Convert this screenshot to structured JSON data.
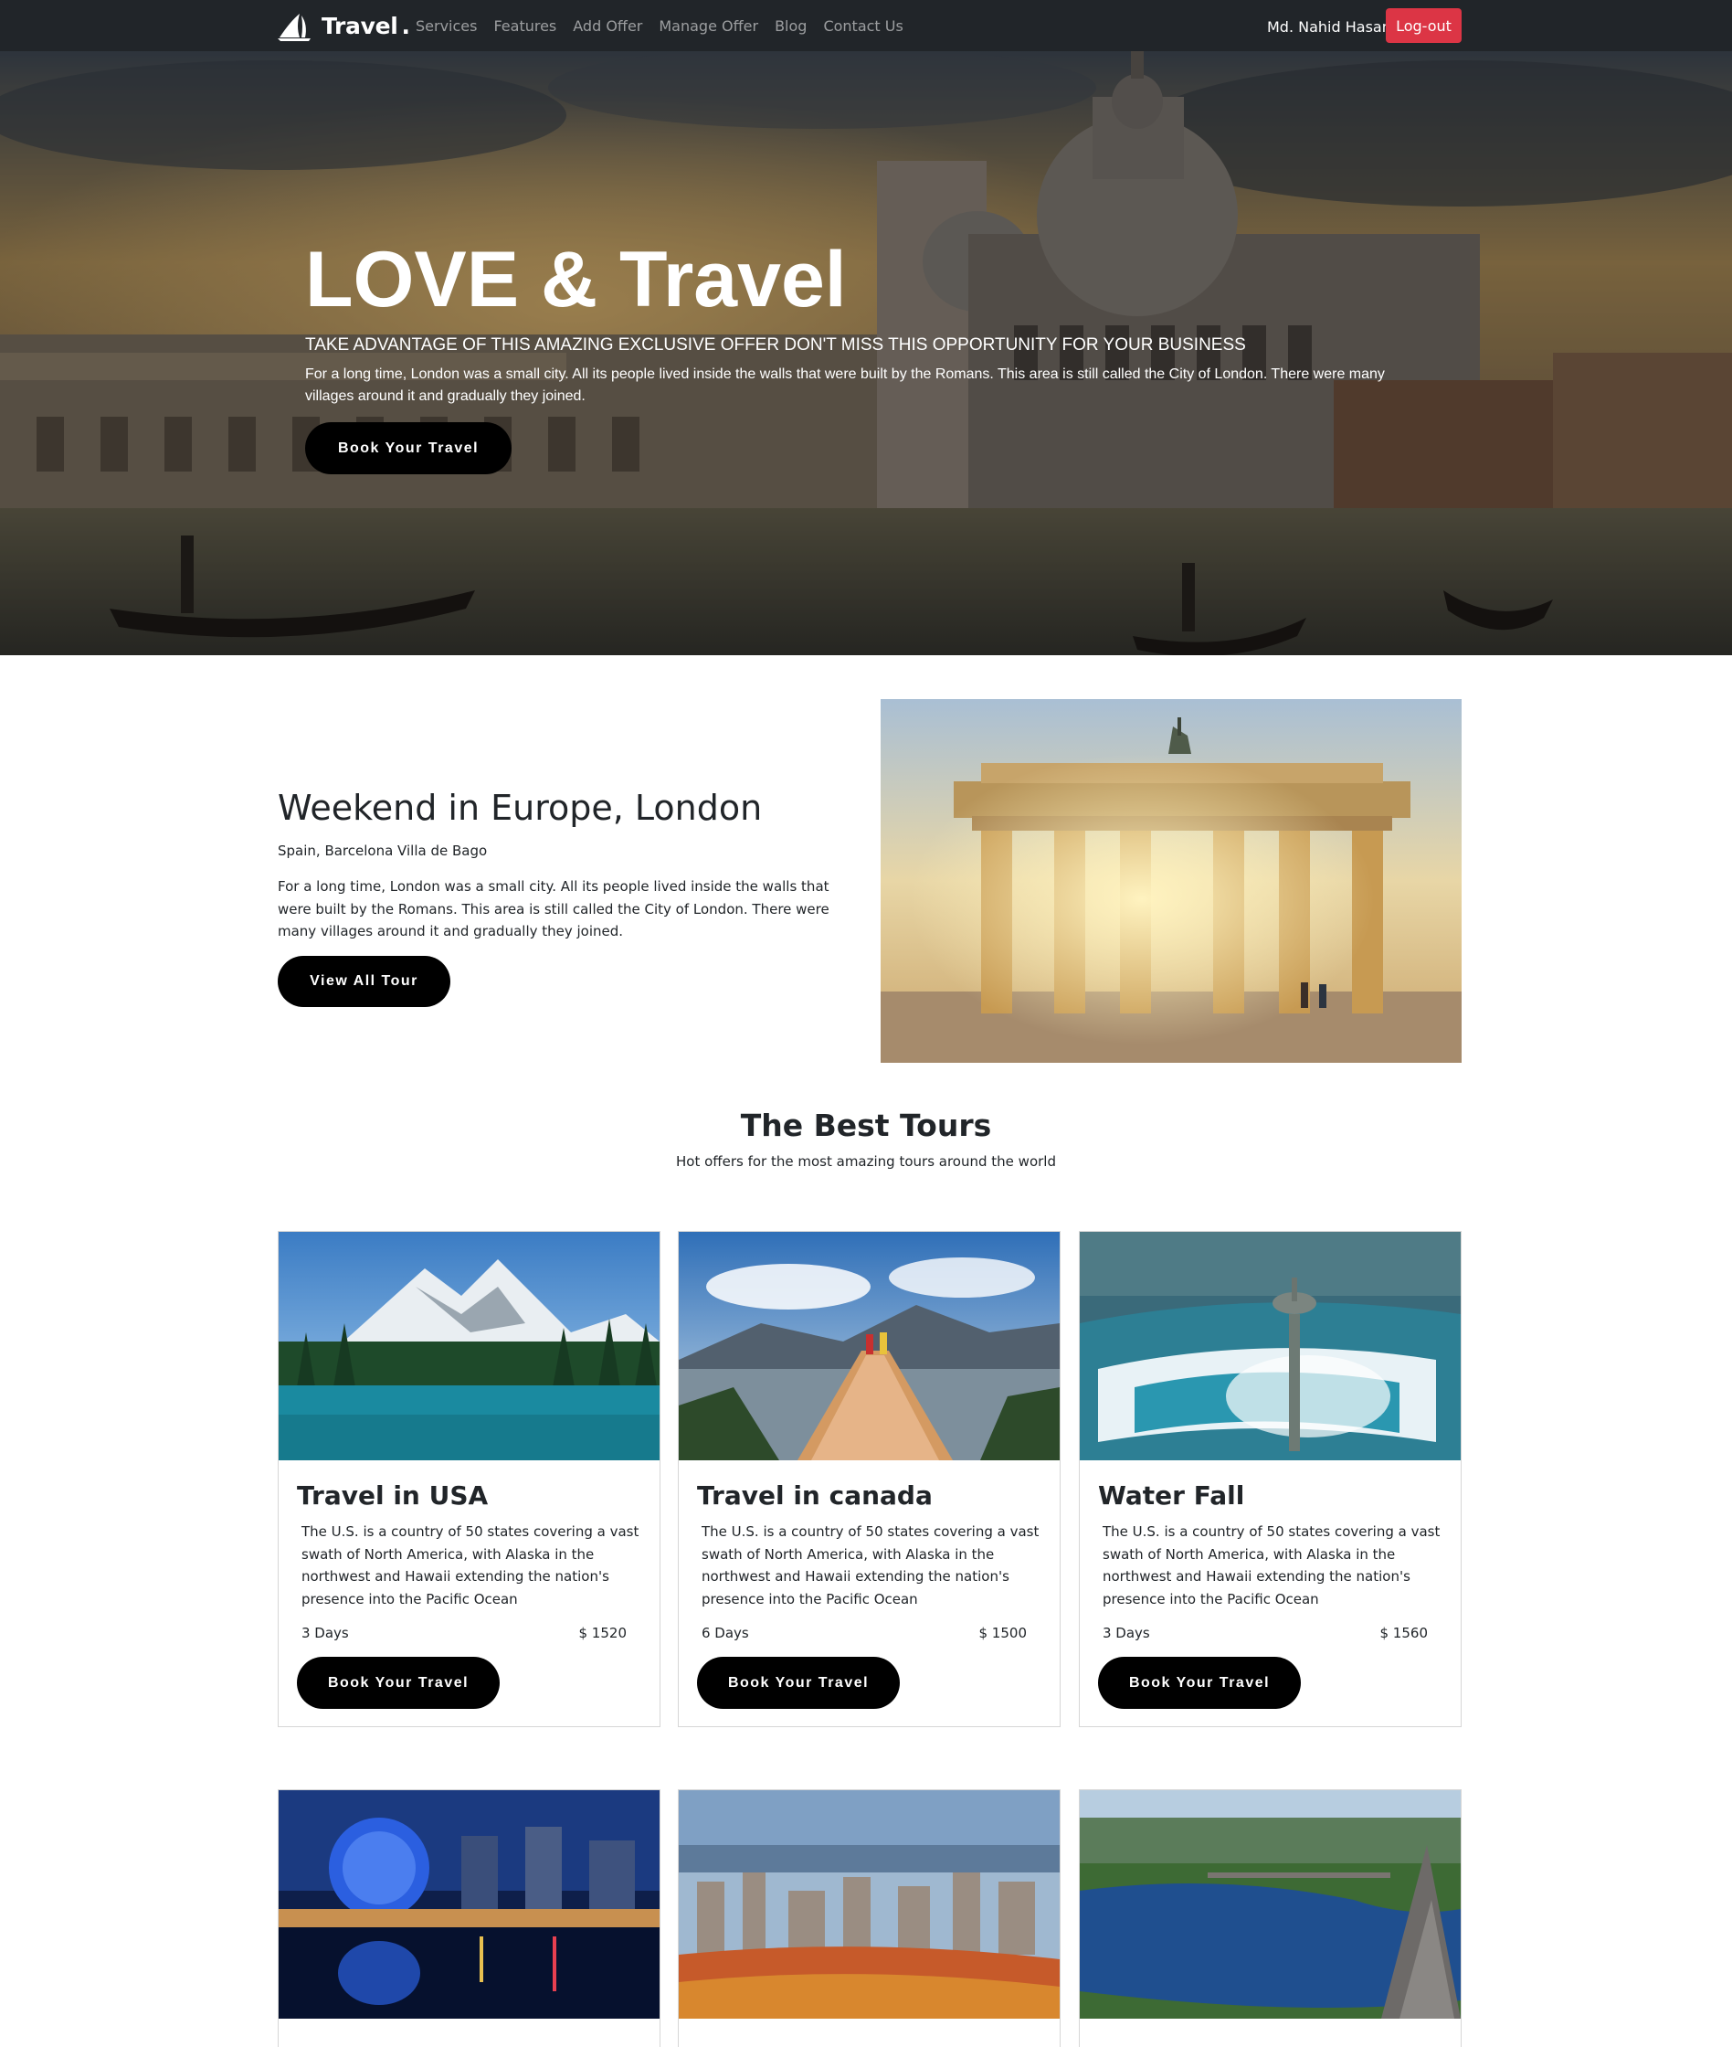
{
  "nav": {
    "brand": "Travel",
    "brand_dot": ".",
    "links": [
      "Services",
      "Features",
      "Add Offer",
      "Manage Offer",
      "Blog",
      "Contact Us"
    ],
    "user_name": "Md. Nahid Hasan",
    "logout_label": "Log-out"
  },
  "hero": {
    "title": "LOVE & Travel",
    "subtitle": "TAKE ADVANTAGE OF THIS AMAZING EXCLUSIVE OFFER DON'T MISS THIS OPPORTUNITY FOR YOUR BUSINESS",
    "description": "For a long time, London was a small city. All its people lived inside the walls that were built by the Romans. This area is still called the City of London. There were many villages around it and gradually they joined.",
    "button_label": "Book Your Travel"
  },
  "feature": {
    "title": "Weekend in Europe, London",
    "subtitle": "Spain, Barcelona Villa de Bago",
    "description": "For a long time, London was a small city. All its people lived inside the walls that were built by the Romans. This area is still called the City of London. There were many villages around it and gradually they joined.",
    "button_label": "View All Tour"
  },
  "tours_section": {
    "title": "The Best Tours",
    "subtitle": "Hot offers for the most amazing tours around the world"
  },
  "tours": [
    {
      "title": "Travel in USA",
      "description": "The U.S. is a country of 50 states covering a vast swath of North America, with Alaska in the northwest and Hawaii extending the nation's presence into the Pacific Ocean",
      "days": "3 Days",
      "price": "$ 1520",
      "button_label": "Book Your Travel"
    },
    {
      "title": "Travel in canada",
      "description": "The U.S. is a country of 50 states covering a vast swath of North America, with Alaska in the northwest and Hawaii extending the nation's presence into the Pacific Ocean",
      "days": "6 Days",
      "price": "$ 1500",
      "button_label": "Book Your Travel"
    },
    {
      "title": "Water Fall",
      "description": "The U.S. is a country of 50 states covering a vast swath of North America, with Alaska in the northwest and Hawaii extending the nation's presence into the Pacific Ocean",
      "days": "3 Days",
      "price": "$ 1560",
      "button_label": "Book Your Travel"
    },
    {
      "title": ""
    },
    {
      "title": ""
    },
    {
      "title": ""
    }
  ],
  "colors": {
    "navbar_bg": "#212529",
    "logout_bg": "#dc3545",
    "button_bg": "#000000",
    "nav_link": "rgba(255,255,255,0.55)"
  },
  "icons": {
    "brand_logo": "sailboat-logo-icon"
  }
}
